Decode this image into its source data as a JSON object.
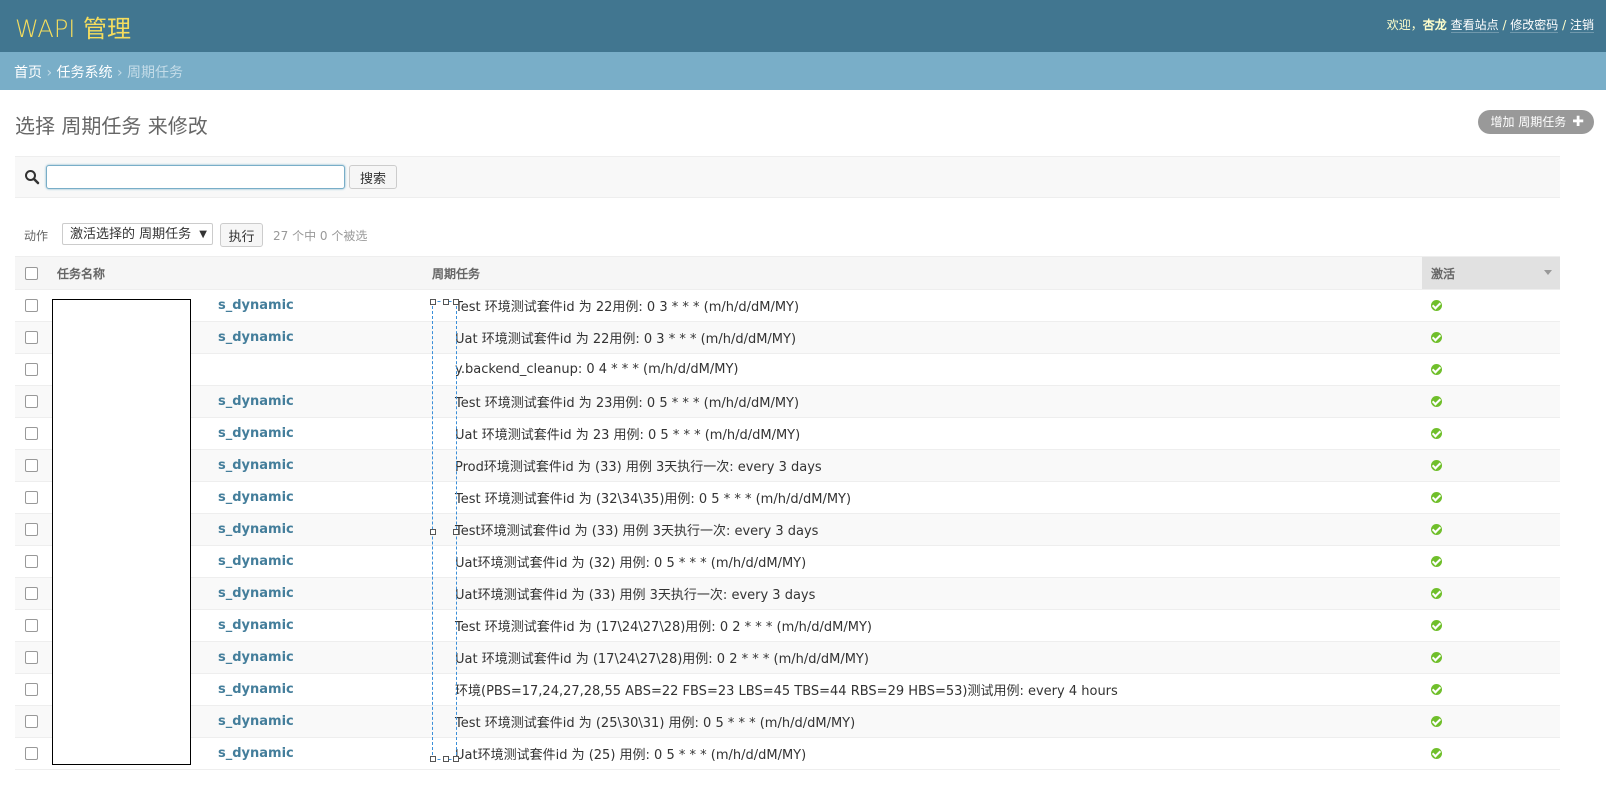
{
  "header": {
    "brand": "WAPI 管理",
    "welcome": "欢迎，",
    "username": "杏龙",
    "view_site": "查看站点",
    "sep1": " / ",
    "change_password": "修改密码",
    "sep2": " / ",
    "logout": "注销"
  },
  "breadcrumbs": {
    "home": "首页",
    "sep": " › ",
    "app": "任务系统",
    "current": "周期任务"
  },
  "page": {
    "title": "选择 周期任务 来修改",
    "add_label": "增加 周期任务",
    "add_icon": "plus-icon"
  },
  "search": {
    "value": "",
    "button": "搜索",
    "icon": "search-icon"
  },
  "actions": {
    "label": "动作",
    "selected": "激活选择的 周期任务",
    "go": "执行",
    "counter": "27 个中 0 个被选"
  },
  "table": {
    "headers": {
      "name": "任务名称",
      "schedule": "周期任务",
      "active": "激活"
    },
    "rows": [
      {
        "name": "s_dynamic",
        "schedule": "Test 环境测试套件id 为 22用例: 0 3 * * * (m/h/d/dM/MY)",
        "active": true
      },
      {
        "name": "s_dynamic",
        "schedule": "Uat 环境测试套件id 为 22用例: 0 3 * * * (m/h/d/dM/MY)",
        "active": true
      },
      {
        "name": "",
        "schedule": "y.backend_cleanup: 0 4 * * * (m/h/d/dM/MY)",
        "active": true
      },
      {
        "name": "s_dynamic",
        "schedule": "Test 环境测试套件id 为 23用例: 0 5 * * * (m/h/d/dM/MY)",
        "active": true
      },
      {
        "name": "s_dynamic",
        "schedule": "Uat 环境测试套件id 为 23 用例: 0 5 * * * (m/h/d/dM/MY)",
        "active": true
      },
      {
        "name": "s_dynamic",
        "schedule": "Prod环境测试套件id 为 (33) 用例 3天执行一次: every 3 days",
        "active": true
      },
      {
        "name": "s_dynamic",
        "schedule": "Test 环境测试套件id 为 (32\\34\\35)用例: 0 5 * * * (m/h/d/dM/MY)",
        "active": true
      },
      {
        "name": "s_dynamic",
        "schedule": "Test环境测试套件id 为 (33) 用例 3天执行一次: every 3 days",
        "active": true
      },
      {
        "name": "s_dynamic",
        "schedule": "Uat环境测试套件id 为 (32) 用例: 0 5 * * * (m/h/d/dM/MY)",
        "active": true
      },
      {
        "name": "s_dynamic",
        "schedule": "Uat环境测试套件id 为 (33) 用例 3天执行一次: every 3 days",
        "active": true
      },
      {
        "name": "s_dynamic",
        "schedule": "Test 环境测试套件id 为 (17\\24\\27\\28)用例: 0 2 * * * (m/h/d/dM/MY)",
        "active": true
      },
      {
        "name": "s_dynamic",
        "schedule": "Uat 环境测试套件id 为 (17\\24\\27\\28)用例: 0 2 * * * (m/h/d/dM/MY)",
        "active": true
      },
      {
        "name": "s_dynamic",
        "schedule": " 环境(PBS=17,24,27,28,55 ABS=22 FBS=23 LBS=45 TBS=44 RBS=29 HBS=53)测试用例: every 4 hours",
        "active": true
      },
      {
        "name": "s_dynamic",
        "schedule": "Test 环境测试套件id 为 (25\\30\\31) 用例: 0 5 * * * (m/h/d/dM/MY)",
        "active": true
      },
      {
        "name": "s_dynamic",
        "schedule": "Uat环境测试套件id 为 (25) 用例: 0 5 * * * (m/h/d/dM/MY)",
        "active": true
      }
    ]
  },
  "colors": {
    "header_bg": "#417690",
    "brand": "#f5dd5d",
    "breadcrumb_bg": "#79aec8",
    "link": "#447e9b",
    "ok": "#70bf2b"
  }
}
